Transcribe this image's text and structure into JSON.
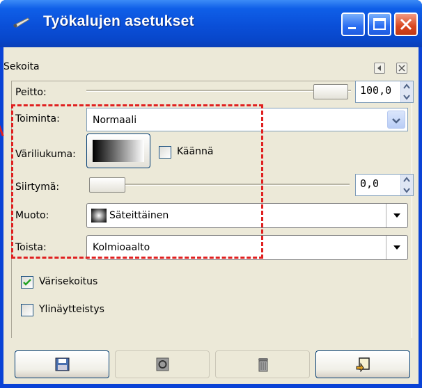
{
  "window": {
    "title": "Työkalujen asetukset"
  },
  "panel": {
    "title": "Sekoita"
  },
  "opacity": {
    "label": "Peitto:",
    "value": "100,0",
    "level": 1.0
  },
  "mode": {
    "label": "Toiminta:",
    "value": "Normaali"
  },
  "gradient": {
    "label": "Väriliukuma:",
    "reverse_label": "Käännä"
  },
  "offset": {
    "label": "Siirtymä:",
    "value": "0,0",
    "level": 0.0
  },
  "shape": {
    "label": "Muoto:",
    "value": "Säteittäinen"
  },
  "repeat": {
    "label": "Toista:",
    "value": "Kolmioaalto"
  },
  "dither": {
    "label": "Värisekoitus",
    "checked": true
  },
  "supersampling": {
    "label": "Ylinäytteistys",
    "checked": false
  },
  "colors": {
    "highlight": "#e02020",
    "title_bar": "#0a4fd8",
    "panel_bg": "#ece9d8"
  },
  "icons": [
    "app-icon",
    "minimize-icon",
    "maximize-icon",
    "close-icon",
    "save-icon",
    "restore-icon",
    "delete-icon",
    "reset-icon"
  ]
}
